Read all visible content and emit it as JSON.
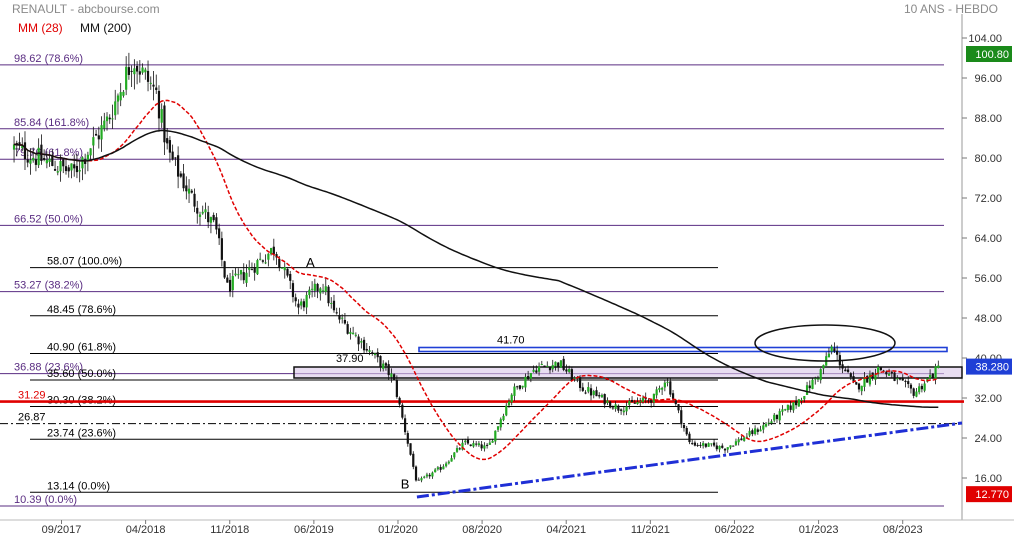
{
  "header": {
    "title": "RENAULT - abcbourse.com",
    "period": "10 ANS - HEBDO"
  },
  "legend": [
    {
      "label": "MM (28)",
      "color": "#e00000"
    },
    {
      "label": "MM (200)",
      "color": "#111111"
    }
  ],
  "colors": {
    "fib_upper": "#5a2d82",
    "fib_lower": "#000000",
    "support": "#e00000",
    "resistance": "#1f3fd6",
    "trendline": "#1f2fd6",
    "candle_up": "#22aa22",
    "candle_down": "#111111",
    "ma28": "#e00000",
    "ma200": "#111111",
    "last_price_bg": "#1f3fd6",
    "high_bg": "#1a8a1a",
    "low_bg": "#e00000"
  },
  "chart_data": {
    "type": "candlestick",
    "title": "RENAULT",
    "x_ticks": [
      "09/2017",
      "04/2018",
      "11/2018",
      "06/2019",
      "01/2020",
      "08/2020",
      "04/2021",
      "11/2021",
      "06/2022",
      "01/2023",
      "08/2023"
    ],
    "y_ticks": [
      "104.00",
      "96.00",
      "88.00",
      "80.00",
      "72.00",
      "64.00",
      "56.00",
      "48.00",
      "40.00",
      "32.00",
      "24.00",
      "16.00"
    ],
    "ylim": [
      10.39,
      104.0
    ],
    "grid": false,
    "price_path": [
      {
        "date": "2017-05",
        "close": 82
      },
      {
        "date": "2017-07",
        "close": 80
      },
      {
        "date": "2017-10",
        "close": 77
      },
      {
        "date": "2018-01",
        "close": 88
      },
      {
        "date": "2018-03",
        "close": 100
      },
      {
        "date": "2018-05",
        "close": 93
      },
      {
        "date": "2018-06",
        "close": 81
      },
      {
        "date": "2018-08",
        "close": 72
      },
      {
        "date": "2018-10",
        "close": 66
      },
      {
        "date": "2018-11",
        "close": 54
      },
      {
        "date": "2019-01",
        "close": 58
      },
      {
        "date": "2019-03",
        "close": 62
      },
      {
        "date": "2019-05",
        "close": 50
      },
      {
        "date": "2019-07",
        "close": 55
      },
      {
        "date": "2019-08",
        "close": 49
      },
      {
        "date": "2019-10",
        "close": 44
      },
      {
        "date": "2020-01",
        "close": 36
      },
      {
        "date": "2020-03",
        "close": 15
      },
      {
        "date": "2020-05",
        "close": 18
      },
      {
        "date": "2020-07",
        "close": 23
      },
      {
        "date": "2020-09",
        "close": 22
      },
      {
        "date": "2020-11",
        "close": 33
      },
      {
        "date": "2021-01",
        "close": 38
      },
      {
        "date": "2021-03",
        "close": 39
      },
      {
        "date": "2021-05",
        "close": 34
      },
      {
        "date": "2021-08",
        "close": 30
      },
      {
        "date": "2021-11",
        "close": 32
      },
      {
        "date": "2021-12",
        "close": 36
      },
      {
        "date": "2022-02",
        "close": 23
      },
      {
        "date": "2022-05",
        "close": 22
      },
      {
        "date": "2022-08",
        "close": 26
      },
      {
        "date": "2022-11",
        "close": 31
      },
      {
        "date": "2023-01",
        "close": 37
      },
      {
        "date": "2023-02",
        "close": 42
      },
      {
        "date": "2023-04",
        "close": 34
      },
      {
        "date": "2023-06",
        "close": 38
      },
      {
        "date": "2023-09",
        "close": 33
      },
      {
        "date": "2023-11",
        "close": 38
      }
    ],
    "last_price": "38.280",
    "period_high": "100.80",
    "period_low": "12.770",
    "series": [
      {
        "name": "MM (28)",
        "style": "dashed"
      },
      {
        "name": "MM (200)",
        "style": "solid"
      }
    ],
    "fib_upper": [
      {
        "label": "98.62",
        "pct": "(78.6%)",
        "value": 98.62
      },
      {
        "label": "85.84",
        "pct": "(161.8%)",
        "value": 85.84
      },
      {
        "label": "79.76",
        "pct": "(61.8%)",
        "value": 79.76
      },
      {
        "label": "66.52",
        "pct": "(50.0%)",
        "value": 66.52
      },
      {
        "label": "53.27",
        "pct": "(38.2%)",
        "value": 53.27
      },
      {
        "label": "36.88",
        "pct": "(23.6%)",
        "value": 36.88
      },
      {
        "label": "10.39",
        "pct": "(0.0%)",
        "value": 10.39
      }
    ],
    "fib_lower": [
      {
        "label": "58.07",
        "pct": "(100.0%)",
        "value": 58.07
      },
      {
        "label": "48.45",
        "pct": "(78.6%)",
        "value": 48.45
      },
      {
        "label": "40.90",
        "pct": "(61.8%)",
        "value": 40.9
      },
      {
        "label": "35.60",
        "pct": "(50.0%)",
        "value": 35.6
      },
      {
        "label": "30.30",
        "pct": "(38.2%)",
        "value": 30.3
      },
      {
        "label": "23.74",
        "pct": "(23.6%)",
        "value": 23.74
      },
      {
        "label": "13.14",
        "pct": "(0.0%)",
        "value": 13.14
      }
    ],
    "support_level": {
      "label": "31.29",
      "value": 31.29
    },
    "dashdot_level": {
      "label": "26.87",
      "value": 26.87
    },
    "resistance_level": {
      "label": "41.70",
      "value": 41.7
    },
    "zone_label": "37.90",
    "zone_range": [
      36.0,
      38.2
    ],
    "annotations": [
      {
        "label": "A",
        "date": "2019-06",
        "value": 57.8
      },
      {
        "label": "B",
        "date": "2020-02",
        "value": 13.5
      }
    ],
    "trendline": {
      "from": {
        "date": "2020-03",
        "value": 12.2
      },
      "to": {
        "date": "2024-01",
        "value": 27.0
      }
    }
  }
}
